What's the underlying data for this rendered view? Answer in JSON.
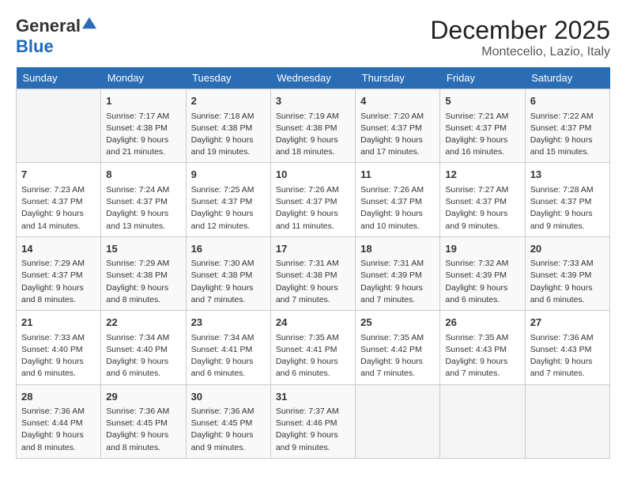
{
  "logo": {
    "general": "General",
    "blue": "Blue"
  },
  "title": "December 2025",
  "location": "Montecelio, Lazio, Italy",
  "weekdays": [
    "Sunday",
    "Monday",
    "Tuesday",
    "Wednesday",
    "Thursday",
    "Friday",
    "Saturday"
  ],
  "weeks": [
    [
      {
        "day": "",
        "content": ""
      },
      {
        "day": "1",
        "content": "Sunrise: 7:17 AM\nSunset: 4:38 PM\nDaylight: 9 hours\nand 21 minutes."
      },
      {
        "day": "2",
        "content": "Sunrise: 7:18 AM\nSunset: 4:38 PM\nDaylight: 9 hours\nand 19 minutes."
      },
      {
        "day": "3",
        "content": "Sunrise: 7:19 AM\nSunset: 4:38 PM\nDaylight: 9 hours\nand 18 minutes."
      },
      {
        "day": "4",
        "content": "Sunrise: 7:20 AM\nSunset: 4:37 PM\nDaylight: 9 hours\nand 17 minutes."
      },
      {
        "day": "5",
        "content": "Sunrise: 7:21 AM\nSunset: 4:37 PM\nDaylight: 9 hours\nand 16 minutes."
      },
      {
        "day": "6",
        "content": "Sunrise: 7:22 AM\nSunset: 4:37 PM\nDaylight: 9 hours\nand 15 minutes."
      }
    ],
    [
      {
        "day": "7",
        "content": "Sunrise: 7:23 AM\nSunset: 4:37 PM\nDaylight: 9 hours\nand 14 minutes."
      },
      {
        "day": "8",
        "content": "Sunrise: 7:24 AM\nSunset: 4:37 PM\nDaylight: 9 hours\nand 13 minutes."
      },
      {
        "day": "9",
        "content": "Sunrise: 7:25 AM\nSunset: 4:37 PM\nDaylight: 9 hours\nand 12 minutes."
      },
      {
        "day": "10",
        "content": "Sunrise: 7:26 AM\nSunset: 4:37 PM\nDaylight: 9 hours\nand 11 minutes."
      },
      {
        "day": "11",
        "content": "Sunrise: 7:26 AM\nSunset: 4:37 PM\nDaylight: 9 hours\nand 10 minutes."
      },
      {
        "day": "12",
        "content": "Sunrise: 7:27 AM\nSunset: 4:37 PM\nDaylight: 9 hours\nand 9 minutes."
      },
      {
        "day": "13",
        "content": "Sunrise: 7:28 AM\nSunset: 4:37 PM\nDaylight: 9 hours\nand 9 minutes."
      }
    ],
    [
      {
        "day": "14",
        "content": "Sunrise: 7:29 AM\nSunset: 4:37 PM\nDaylight: 9 hours\nand 8 minutes."
      },
      {
        "day": "15",
        "content": "Sunrise: 7:29 AM\nSunset: 4:38 PM\nDaylight: 9 hours\nand 8 minutes."
      },
      {
        "day": "16",
        "content": "Sunrise: 7:30 AM\nSunset: 4:38 PM\nDaylight: 9 hours\nand 7 minutes."
      },
      {
        "day": "17",
        "content": "Sunrise: 7:31 AM\nSunset: 4:38 PM\nDaylight: 9 hours\nand 7 minutes."
      },
      {
        "day": "18",
        "content": "Sunrise: 7:31 AM\nSunset: 4:39 PM\nDaylight: 9 hours\nand 7 minutes."
      },
      {
        "day": "19",
        "content": "Sunrise: 7:32 AM\nSunset: 4:39 PM\nDaylight: 9 hours\nand 6 minutes."
      },
      {
        "day": "20",
        "content": "Sunrise: 7:33 AM\nSunset: 4:39 PM\nDaylight: 9 hours\nand 6 minutes."
      }
    ],
    [
      {
        "day": "21",
        "content": "Sunrise: 7:33 AM\nSunset: 4:40 PM\nDaylight: 9 hours\nand 6 minutes."
      },
      {
        "day": "22",
        "content": "Sunrise: 7:34 AM\nSunset: 4:40 PM\nDaylight: 9 hours\nand 6 minutes."
      },
      {
        "day": "23",
        "content": "Sunrise: 7:34 AM\nSunset: 4:41 PM\nDaylight: 9 hours\nand 6 minutes."
      },
      {
        "day": "24",
        "content": "Sunrise: 7:35 AM\nSunset: 4:41 PM\nDaylight: 9 hours\nand 6 minutes."
      },
      {
        "day": "25",
        "content": "Sunrise: 7:35 AM\nSunset: 4:42 PM\nDaylight: 9 hours\nand 7 minutes."
      },
      {
        "day": "26",
        "content": "Sunrise: 7:35 AM\nSunset: 4:43 PM\nDaylight: 9 hours\nand 7 minutes."
      },
      {
        "day": "27",
        "content": "Sunrise: 7:36 AM\nSunset: 4:43 PM\nDaylight: 9 hours\nand 7 minutes."
      }
    ],
    [
      {
        "day": "28",
        "content": "Sunrise: 7:36 AM\nSunset: 4:44 PM\nDaylight: 9 hours\nand 8 minutes."
      },
      {
        "day": "29",
        "content": "Sunrise: 7:36 AM\nSunset: 4:45 PM\nDaylight: 9 hours\nand 8 minutes."
      },
      {
        "day": "30",
        "content": "Sunrise: 7:36 AM\nSunset: 4:45 PM\nDaylight: 9 hours\nand 9 minutes."
      },
      {
        "day": "31",
        "content": "Sunrise: 7:37 AM\nSunset: 4:46 PM\nDaylight: 9 hours\nand 9 minutes."
      },
      {
        "day": "",
        "content": ""
      },
      {
        "day": "",
        "content": ""
      },
      {
        "day": "",
        "content": ""
      }
    ]
  ]
}
